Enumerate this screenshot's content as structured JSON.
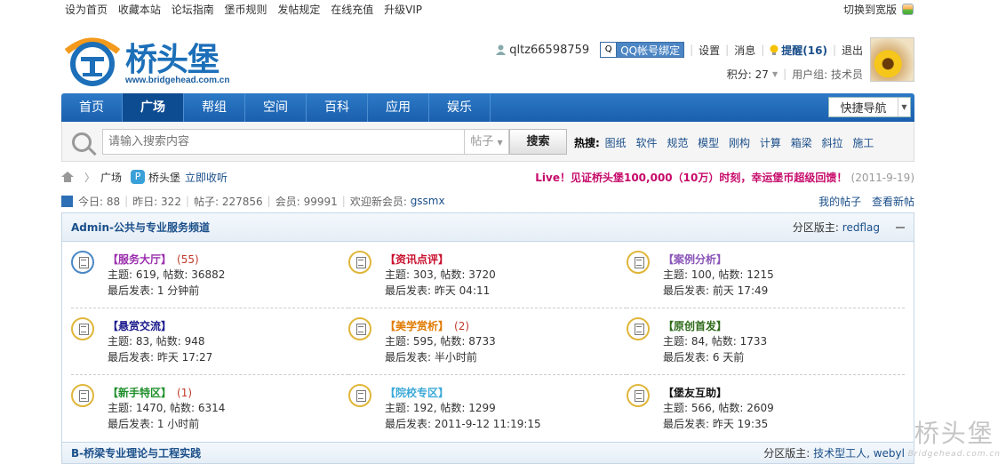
{
  "topbar": {
    "links": [
      "设为首页",
      "收藏本站",
      "论坛指南",
      "堡币规则",
      "发帖规定",
      "在线充值",
      "升级VIP"
    ],
    "switch_label": "切换到宽版"
  },
  "logo": {
    "name": "桥头堡",
    "url": "www.bridgehead.com.cn"
  },
  "user": {
    "username": "qltz66598759",
    "qq_bind": "QQ帐号绑定",
    "settings": "设置",
    "messages": "消息",
    "remind": "提醒(16)",
    "logout": "退出",
    "points": "积分: 27",
    "group": "用户组: 技术员"
  },
  "nav": {
    "items": [
      "首页",
      "广场",
      "帮组",
      "空间",
      "百科",
      "应用",
      "娱乐"
    ],
    "active": "广场",
    "quick": "快捷导航"
  },
  "search": {
    "placeholder": "请输入搜索内容",
    "type": "帖子",
    "button": "搜索",
    "hot_label": "热搜:",
    "hot": [
      "图纸",
      "软件",
      "规范",
      "模型",
      "刚构",
      "计算",
      "箱梁",
      "斜拉",
      "施工"
    ]
  },
  "breadcrumb": {
    "current": "广场",
    "site": "桥头堡",
    "collect": "立即收听",
    "announce": "Live！见证桥头堡100,000（10万）时刻，幸运堡币超级回馈！",
    "announce_date": "(2011-9-19)"
  },
  "stats": {
    "today": "今日: 88",
    "yesterday": "昨日: 322",
    "posts": "帖子: 227856",
    "members": "会员: 99991",
    "welcome": "欢迎新会员:",
    "new_member": "gssmx",
    "my_posts": "我的帖子",
    "new_posts": "查看新帖"
  },
  "section1": {
    "title": "Admin-公共与专业服务频道",
    "mod_label": "分区版主:",
    "moderator": "redflag",
    "rows": [
      [
        {
          "name": "【服务大厅】",
          "count": "(55)",
          "color": "#9b2fae",
          "topics": "主题: 619, 帖数: 36882",
          "last": "最后发表: 1 分钟前",
          "icon": "blue"
        },
        {
          "name": "【资讯点评】",
          "count": "",
          "color": "#c8102e",
          "topics": "主题: 303, 帖数: 3720",
          "last": "最后发表: 昨天 04:11",
          "icon": "gold"
        },
        {
          "name": "【案例分析】",
          "count": "",
          "color": "#8a54b8",
          "topics": "主题: 100, 帖数: 1215",
          "last": "最后发表: 前天 17:49",
          "icon": "gold"
        }
      ],
      [
        {
          "name": "【悬赏交流】",
          "count": "",
          "color": "#1a1a8c",
          "topics": "主题: 83, 帖数: 948",
          "last": "最后发表: 昨天 17:27",
          "icon": "gold"
        },
        {
          "name": "【美学赏析】",
          "count": "(2)",
          "color": "#e07b00",
          "topics": "主题: 595, 帖数: 8733",
          "last": "最后发表: 半小时前",
          "icon": "gold"
        },
        {
          "name": "【原创首发】",
          "count": "",
          "color": "#2e6b1a",
          "topics": "主题: 84, 帖数: 1733",
          "last": "最后发表: 6 天前",
          "icon": "gold"
        }
      ],
      [
        {
          "name": "【新手特区】",
          "count": "(1)",
          "color": "#1f8f2a",
          "topics": "主题: 1470, 帖数: 6314",
          "last": "最后发表: 1 小时前",
          "icon": "gold"
        },
        {
          "name": "【院校专区】",
          "count": "",
          "color": "#3ba9d8",
          "topics": "主题: 192, 帖数: 1299",
          "last": "最后发表: 2011-9-12 11:19:15",
          "icon": "gold"
        },
        {
          "name": "【堡友互助】",
          "count": "",
          "color": "#111111",
          "topics": "主题: 566, 帖数: 2609",
          "last": "最后发表: 昨天 19:35",
          "icon": "gold"
        }
      ]
    ]
  },
  "section2": {
    "title": "B-桥梁专业理论与工程实践",
    "mod_label": "分区版主:",
    "moderators": "技术型工人, webyl"
  },
  "watermark": {
    "big": "桥头堡",
    "small": "Bridgehead.com.cn"
  }
}
